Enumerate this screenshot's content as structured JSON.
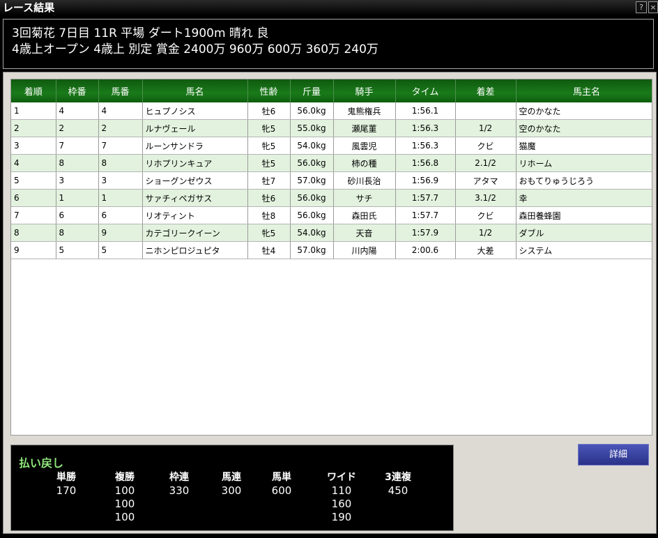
{
  "window": {
    "title": "レース結果",
    "help": "?",
    "close": "×"
  },
  "race": {
    "line1": "3回菊花 7日目 11R 平場 ダート1900m 晴れ 良",
    "line2": "4歳上オープン 4歳上 別定 賞金 2400万 960万 600万 360万 240万"
  },
  "table": {
    "headers": [
      "着順",
      "枠番",
      "馬番",
      "馬名",
      "性齢",
      "斤量",
      "騎手",
      "タイム",
      "着差",
      "馬主名"
    ],
    "rows": [
      [
        "1",
        "4",
        "4",
        "ヒュプノシス",
        "牡6",
        "56.0kg",
        "鬼熊権兵",
        "1:56.1",
        "",
        "空のかなた"
      ],
      [
        "2",
        "2",
        "2",
        "ルナヴェール",
        "牝5",
        "55.0kg",
        "瀬尾菫",
        "1:56.3",
        "1/2",
        "空のかなた"
      ],
      [
        "3",
        "7",
        "7",
        "ルーンサンドラ",
        "牝5",
        "54.0kg",
        "風雲児",
        "1:56.3",
        "クビ",
        "猫魔"
      ],
      [
        "4",
        "8",
        "8",
        "リホプリンキュア",
        "牡5",
        "56.0kg",
        "柿の種",
        "1:56.8",
        "2.1/2",
        "リホーム"
      ],
      [
        "5",
        "3",
        "3",
        "ショーグンゼウス",
        "牡7",
        "57.0kg",
        "砂川長治",
        "1:56.9",
        "アタマ",
        "おもてりゅうじろう"
      ],
      [
        "6",
        "1",
        "1",
        "サァチィペガサス",
        "牡6",
        "56.0kg",
        "サチ",
        "1:57.7",
        "3.1/2",
        "幸"
      ],
      [
        "7",
        "6",
        "6",
        "リオティント",
        "牡8",
        "56.0kg",
        "森田氏",
        "1:57.7",
        "クビ",
        "森田養蜂園"
      ],
      [
        "8",
        "8",
        "9",
        "カテゴリークイーン",
        "牝5",
        "54.0kg",
        "天音",
        "1:57.9",
        "1/2",
        "ダブル"
      ],
      [
        "9",
        "5",
        "5",
        "ニホンピロジュピタ",
        "牡4",
        "57.0kg",
        "川内陽",
        "2:00.6",
        "大差",
        "システム"
      ]
    ]
  },
  "payout": {
    "title": "払い戻し",
    "columns": [
      {
        "label": "単勝",
        "values": [
          "170"
        ]
      },
      {
        "label": "複勝",
        "values": [
          "100",
          "100",
          "100"
        ]
      },
      {
        "label": "枠連",
        "values": [
          "330"
        ]
      },
      {
        "label": "馬連",
        "values": [
          "300"
        ]
      },
      {
        "label": "馬単",
        "values": [
          "600"
        ]
      },
      {
        "label": "ワイド",
        "values": [
          "110",
          "160",
          "190"
        ]
      },
      {
        "label": "3連複",
        "values": [
          "450"
        ]
      }
    ]
  },
  "detail_button": "詳細"
}
